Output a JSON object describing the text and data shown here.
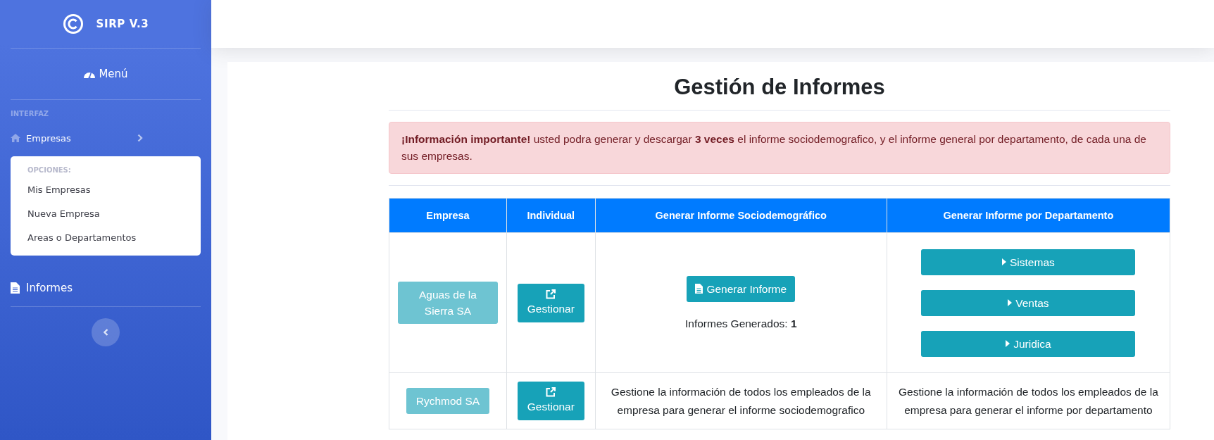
{
  "sidebar": {
    "brand": "SIRP V.3",
    "menu_link": "Menú",
    "section_heading": "INTERFAZ",
    "nav_items": [
      {
        "kind": "collapsible",
        "label": "Empresas",
        "expanded": true,
        "submenu": {
          "heading": "OPCIONES:",
          "items": [
            "Mis Empresas",
            "Nueva Empresa",
            "Areas o Departamentos"
          ]
        }
      },
      {
        "kind": "link",
        "label": "Informes"
      }
    ]
  },
  "main": {
    "title": "Gestión de Informes",
    "alert": "**¡Información importante!** usted podra generar y descargar **3 veces** el informe sociodemografico, y el informe general por departamento, de cada una de sus empresas.",
    "table": {
      "columns": [
        "Empresa",
        "Individual",
        "Generar Informe Sociodemográfico",
        "Generar Informe por Departamento"
      ],
      "rows": [
        {
          "empresa": "Aguas de la Sierra SA",
          "individual": "Gestionar",
          "socio": {
            "kind": "button",
            "button": "Generar Informe",
            "count": "Informes Generados: **1**"
          },
          "departamento": {
            "kind": "buttons",
            "buttons": [
              "Sistemas",
              "Ventas",
              "Juridica"
            ]
          }
        },
        {
          "empresa": "Rychmod SA",
          "individual": "Gestionar",
          "socio": {
            "kind": "text",
            "text": "Gestione la información de todos los empleados de la empresa para generar el informe sociodemografico"
          },
          "departamento": {
            "kind": "text",
            "text": "Gestione la información de todos los empleados de la empresa para generar el informe por departamento"
          }
        }
      ]
    }
  }
}
